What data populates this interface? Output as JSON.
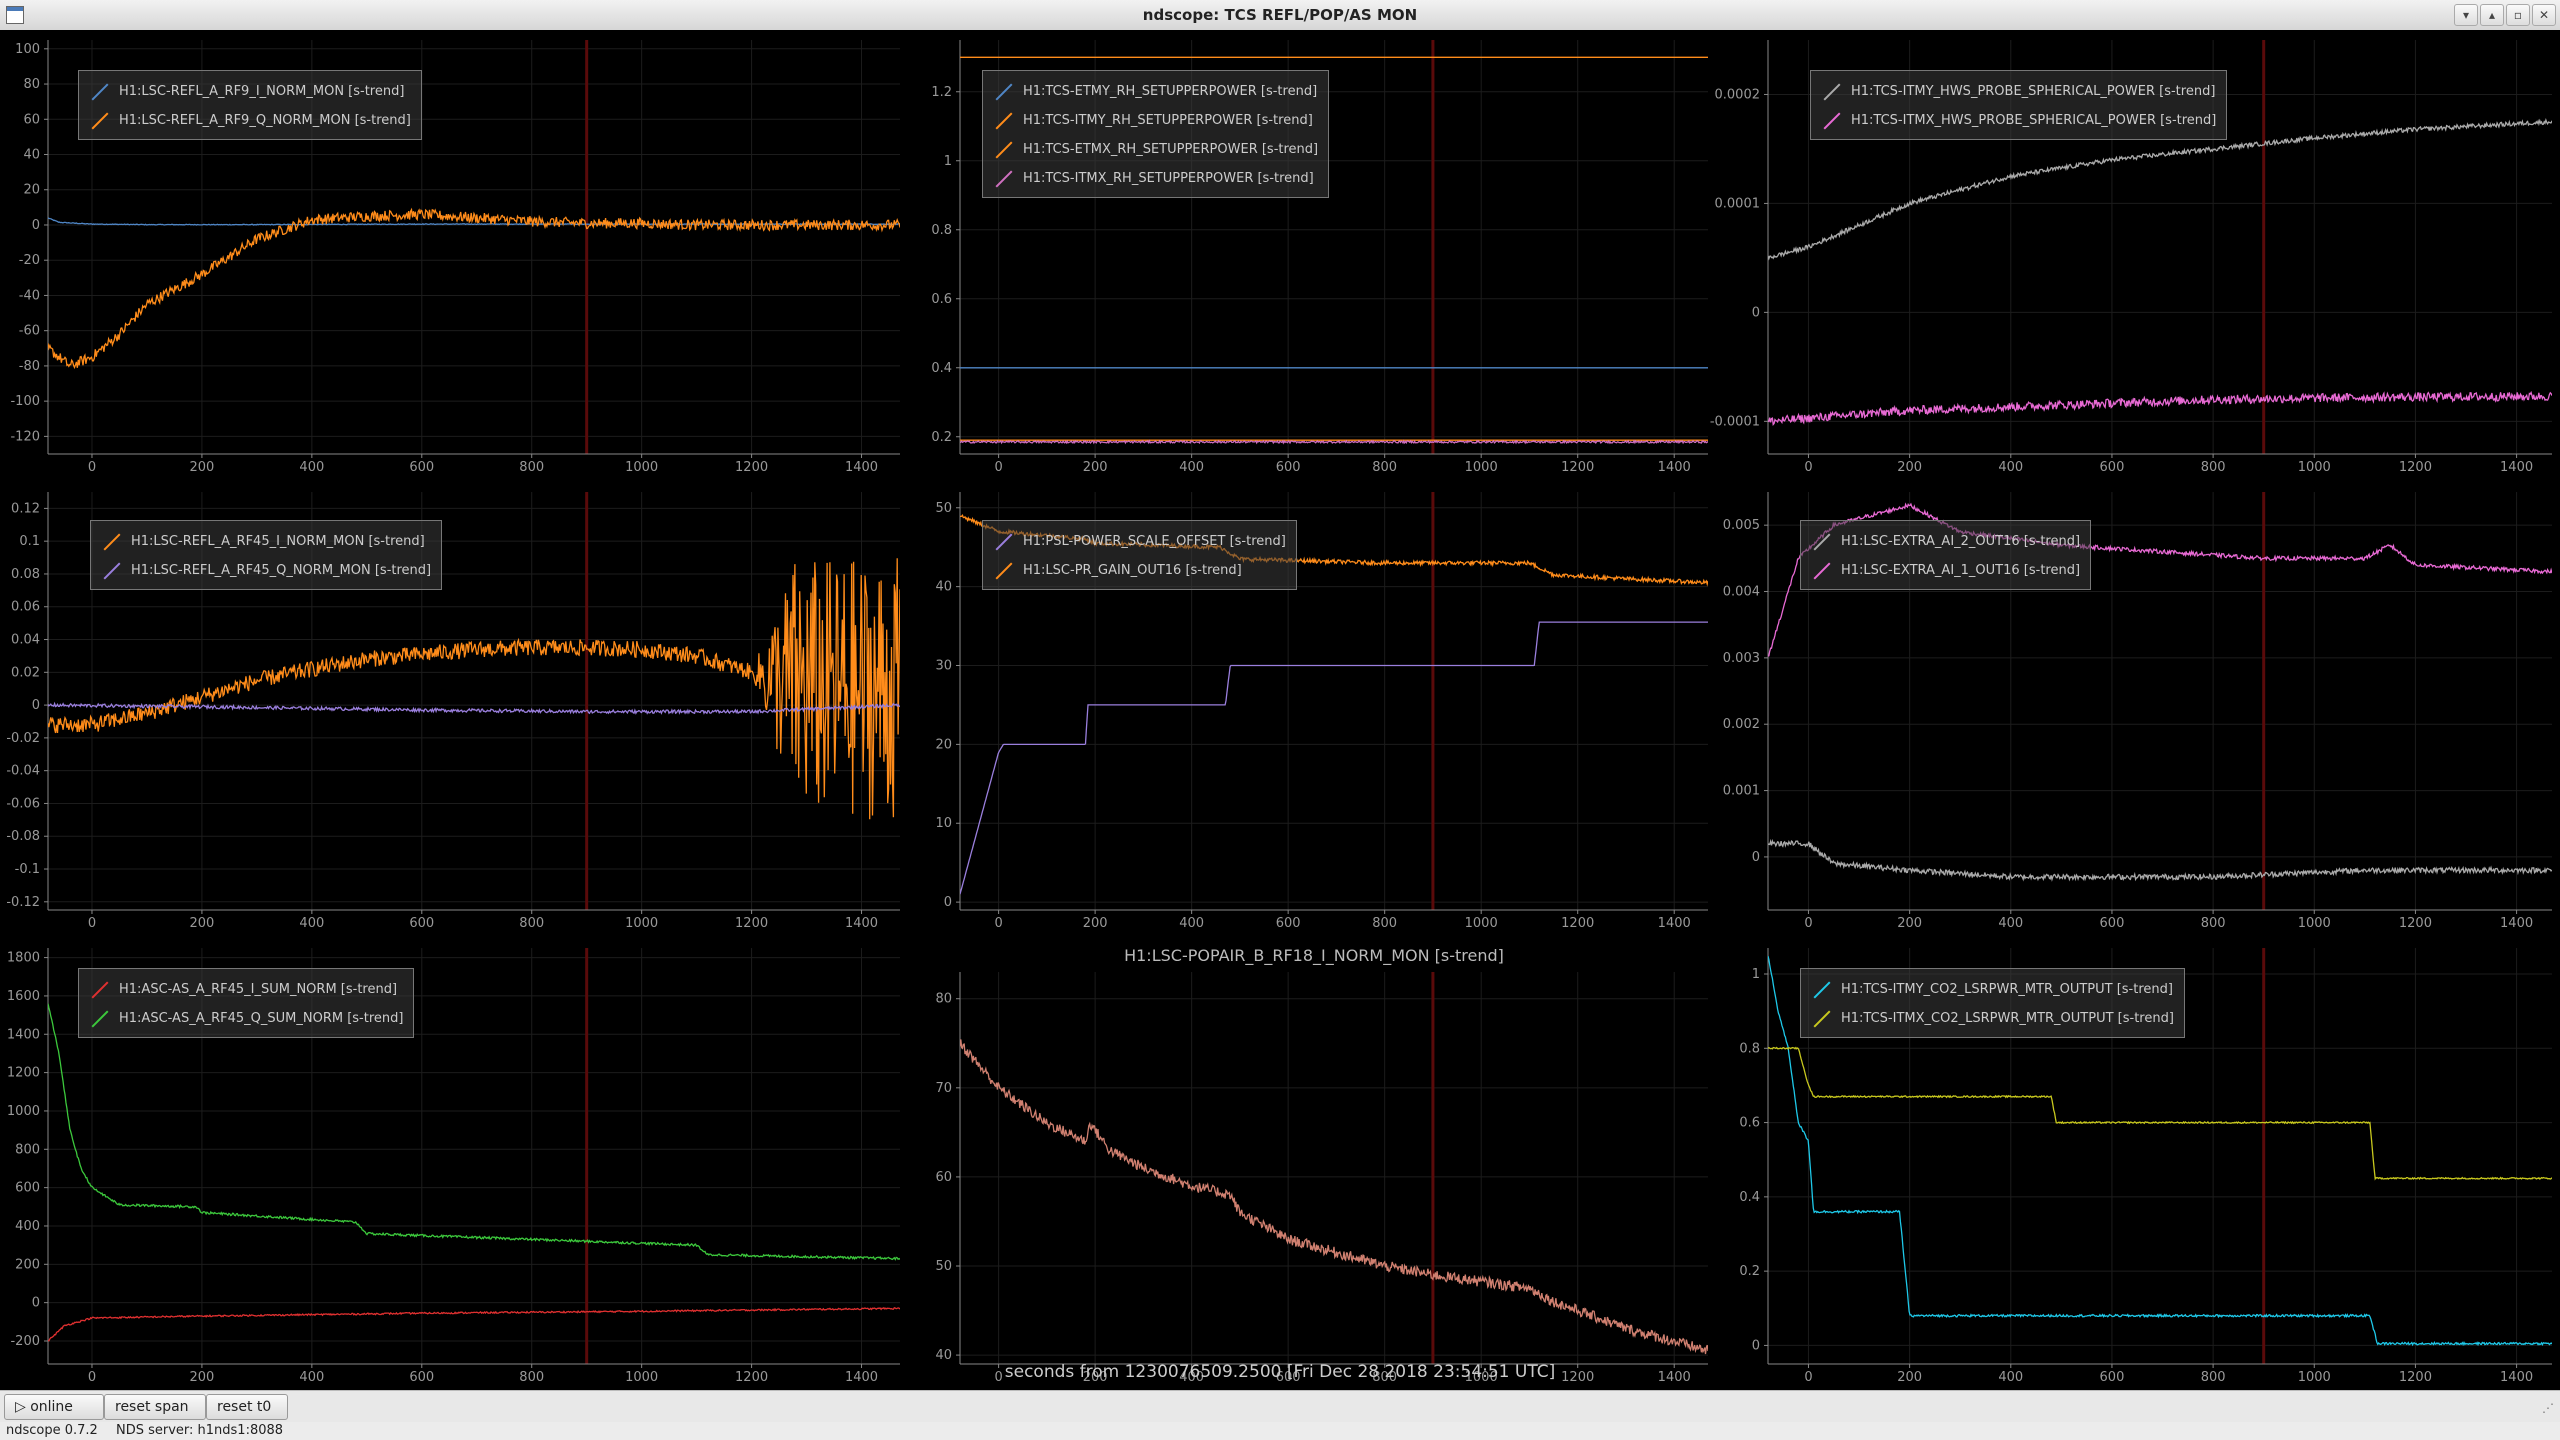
{
  "window": {
    "title": "ndscope: TCS REFL/POP/AS MON",
    "buttons": [
      "▾",
      "▴",
      "▫",
      "✕"
    ]
  },
  "x_axis_label": "seconds from 1230076509.2500 [Fri Dec 28 2018 23:54:51 UTC]",
  "toolbar": {
    "online_label": "▷ online",
    "reset_span_label": "reset span",
    "reset_t0_label": "reset t0"
  },
  "status": {
    "version": "ndscope 0.7.2",
    "server": "NDS server: h1nds1:8088"
  },
  "plots": [
    {
      "id": "refl-rf9",
      "title": "",
      "xlim": [
        -80,
        1470
      ],
      "ylim": [
        -130,
        105
      ],
      "xticks": [
        0,
        200,
        400,
        600,
        800,
        1000,
        1200,
        1400
      ],
      "yticks": [
        100,
        80,
        60,
        40,
        20,
        0,
        -20,
        -40,
        -60,
        -80,
        -100,
        -120
      ],
      "cursor_x": 900,
      "series": [
        {
          "name": "H1:LSC-REFL_A_RF9_I_NORM_MON [s-trend]",
          "color": "#4f86c6",
          "noise": 0.2,
          "points": [
            [
              -80,
              4
            ],
            [
              -60,
              1.5
            ],
            [
              0,
              0.5
            ],
            [
              100,
              0.2
            ],
            [
              300,
              0.2
            ],
            [
              600,
              0.5
            ],
            [
              900,
              0.5
            ],
            [
              1200,
              0.5
            ],
            [
              1470,
              0.5
            ]
          ]
        },
        {
          "name": "H1:LSC-REFL_A_RF9_Q_NORM_MON [s-trend]",
          "color": "#ff8c1a",
          "noise": 3,
          "points": [
            [
              -80,
              -70
            ],
            [
              -40,
              -80
            ],
            [
              0,
              -75
            ],
            [
              50,
              -62
            ],
            [
              100,
              -45
            ],
            [
              200,
              -28
            ],
            [
              300,
              -8
            ],
            [
              400,
              3
            ],
            [
              500,
              5
            ],
            [
              600,
              6
            ],
            [
              700,
              4
            ],
            [
              800,
              2
            ],
            [
              900,
              1
            ],
            [
              1000,
              1
            ],
            [
              1100,
              0
            ],
            [
              1200,
              0
            ],
            [
              1300,
              0
            ],
            [
              1470,
              0
            ]
          ]
        }
      ]
    },
    {
      "id": "tcs-setupper",
      "title": "",
      "xlim": [
        -80,
        1470
      ],
      "ylim": [
        0.15,
        1.35
      ],
      "xticks": [
        0,
        200,
        400,
        600,
        800,
        1000,
        1200,
        1400
      ],
      "yticks": [
        1.2,
        1,
        0.8,
        0.6,
        0.4,
        0.2
      ],
      "cursor_x": 900,
      "series": [
        {
          "name": "H1:TCS-ETMY_RH_SETUPPERPOWER [s-trend]",
          "color": "#4f86c6",
          "noise": 0,
          "points": [
            [
              -80,
              0.4
            ],
            [
              1470,
              0.4
            ]
          ]
        },
        {
          "name": "H1:TCS-ITMY_RH_SETUPPERPOWER [s-trend]",
          "color": "#ff8c1a",
          "noise": 0,
          "points": [
            [
              -80,
              1.3
            ],
            [
              1470,
              1.3
            ]
          ]
        },
        {
          "name": "H1:TCS-ETMX_RH_SETUPPERPOWER [s-trend]",
          "color": "#ff8c1a",
          "noise": 0,
          "points": [
            [
              -80,
              0.19
            ],
            [
              1470,
              0.19
            ]
          ]
        },
        {
          "name": "H1:TCS-ITMX_RH_SETUPPERPOWER [s-trend]",
          "color": "#d070c0",
          "noise": 0.003,
          "points": [
            [
              -80,
              0.185
            ],
            [
              1470,
              0.185
            ]
          ]
        }
      ]
    },
    {
      "id": "hws-spherical",
      "title": "",
      "xlim": [
        -80,
        1470
      ],
      "ylim": [
        -0.00013,
        0.00025
      ],
      "xticks": [
        0,
        200,
        400,
        600,
        800,
        1000,
        1200,
        1400
      ],
      "yticks": [
        0.0002,
        0.0001,
        0,
        -0.0001
      ],
      "cursor_x": 900,
      "series": [
        {
          "name": "H1:TCS-ITMY_HWS_PROBE_SPHERICAL_POWER [s-trend]",
          "color": "#aaaaaa",
          "noise": 2e-06,
          "points": [
            [
              -80,
              5e-05
            ],
            [
              0,
              6e-05
            ],
            [
              100,
              8e-05
            ],
            [
              200,
              0.0001
            ],
            [
              400,
              0.000125
            ],
            [
              600,
              0.00014
            ],
            [
              800,
              0.00015
            ],
            [
              1000,
              0.00016
            ],
            [
              1200,
              0.000168
            ],
            [
              1470,
              0.000175
            ]
          ]
        },
        {
          "name": "H1:TCS-ITMX_HWS_PROBE_SPHERICAL_POWER [s-trend]",
          "color": "#e86ad4",
          "noise": 4e-06,
          "points": [
            [
              -80,
              -0.0001
            ],
            [
              200,
              -9e-05
            ],
            [
              500,
              -8.5e-05
            ],
            [
              800,
              -8e-05
            ],
            [
              1100,
              -7.8e-05
            ],
            [
              1470,
              -7.7e-05
            ]
          ]
        }
      ]
    },
    {
      "id": "refl-rf45",
      "title": "",
      "xlim": [
        -80,
        1470
      ],
      "ylim": [
        -0.125,
        0.13
      ],
      "xticks": [
        0,
        200,
        400,
        600,
        800,
        1000,
        1200,
        1400
      ],
      "yticks": [
        0.12,
        0.1,
        0.08,
        0.06,
        0.04,
        0.02,
        0,
        -0.02,
        -0.04,
        -0.06,
        -0.08,
        -0.1,
        -0.12
      ],
      "cursor_x": 900,
      "series": [
        {
          "name": "H1:LSC-REFL_A_RF45_I_NORM_MON [s-trend]",
          "color": "#ff8c1a",
          "noise": 0.005,
          "burst": [
            1200,
            0.08
          ],
          "points": [
            [
              -80,
              -0.012
            ],
            [
              0,
              -0.012
            ],
            [
              100,
              -0.005
            ],
            [
              200,
              0.005
            ],
            [
              300,
              0.015
            ],
            [
              400,
              0.022
            ],
            [
              500,
              0.028
            ],
            [
              600,
              0.031
            ],
            [
              700,
              0.034
            ],
            [
              800,
              0.035
            ],
            [
              900,
              0.035
            ],
            [
              1000,
              0.034
            ],
            [
              1100,
              0.03
            ],
            [
              1200,
              0.02
            ],
            [
              1300,
              0.01
            ],
            [
              1470,
              0.01
            ]
          ]
        },
        {
          "name": "H1:LSC-REFL_A_RF45_Q_NORM_MON [s-trend]",
          "color": "#9a7fdd",
          "noise": 0.001,
          "points": [
            [
              -80,
              0
            ],
            [
              200,
              -0.001
            ],
            [
              600,
              -0.003
            ],
            [
              900,
              -0.004
            ],
            [
              1200,
              -0.004
            ],
            [
              1470,
              0
            ]
          ]
        }
      ]
    },
    {
      "id": "psl-power",
      "title": "",
      "xlim": [
        -80,
        1470
      ],
      "ylim": [
        -1,
        52
      ],
      "xticks": [
        0,
        200,
        400,
        600,
        800,
        1000,
        1200,
        1400
      ],
      "yticks": [
        50,
        40,
        30,
        20,
        10,
        0
      ],
      "cursor_x": 900,
      "series": [
        {
          "name": "H1:PSL-POWER_SCALE_OFFSET [s-trend]",
          "color": "#9a7fdd",
          "noise": 0,
          "points": [
            [
              -80,
              1
            ],
            [
              -40,
              10
            ],
            [
              0,
              19
            ],
            [
              10,
              20
            ],
            [
              180,
              20
            ],
            [
              185,
              25
            ],
            [
              470,
              25
            ],
            [
              480,
              30
            ],
            [
              1110,
              30
            ],
            [
              1120,
              35.5
            ],
            [
              1470,
              35.5
            ]
          ]
        },
        {
          "name": "H1:LSC-PR_GAIN_OUT16 [s-trend]",
          "color": "#ff8c1a",
          "noise": 0.25,
          "points": [
            [
              -80,
              49
            ],
            [
              0,
              47
            ],
            [
              100,
              46.5
            ],
            [
              180,
              46
            ],
            [
              200,
              45.5
            ],
            [
              460,
              45
            ],
            [
              500,
              43.5
            ],
            [
              800,
              43
            ],
            [
              1100,
              43
            ],
            [
              1150,
              41.5
            ],
            [
              1300,
              41
            ],
            [
              1470,
              40.5
            ]
          ]
        }
      ]
    },
    {
      "id": "extra-ai",
      "title": "",
      "xlim": [
        -80,
        1470
      ],
      "ylim": [
        -0.0008,
        0.0055
      ],
      "xticks": [
        0,
        200,
        400,
        600,
        800,
        1000,
        1200,
        1400
      ],
      "yticks": [
        0.005,
        0.004,
        0.003,
        0.002,
        0.001,
        0
      ],
      "cursor_x": 900,
      "series": [
        {
          "name": "H1:LSC-EXTRA_AI_2_OUT16 [s-trend]",
          "color": "#aaaaaa",
          "noise": 4e-05,
          "points": [
            [
              -80,
              0.0002
            ],
            [
              0,
              0.0002
            ],
            [
              50,
              -0.0001
            ],
            [
              200,
              -0.0002
            ],
            [
              400,
              -0.0003
            ],
            [
              800,
              -0.0003
            ],
            [
              1100,
              -0.0002
            ],
            [
              1470,
              -0.0002
            ]
          ]
        },
        {
          "name": "H1:LSC-EXTRA_AI_1_OUT16 [s-trend]",
          "color": "#e86ad4",
          "noise": 3e-05,
          "points": [
            [
              -80,
              0.003
            ],
            [
              -20,
              0.0045
            ],
            [
              50,
              0.005
            ],
            [
              200,
              0.0053
            ],
            [
              300,
              0.0049
            ],
            [
              500,
              0.0047
            ],
            [
              700,
              0.0046
            ],
            [
              900,
              0.0045
            ],
            [
              1100,
              0.0045
            ],
            [
              1150,
              0.0047
            ],
            [
              1200,
              0.0044
            ],
            [
              1470,
              0.0043
            ]
          ]
        }
      ]
    },
    {
      "id": "as-rf45",
      "title": "",
      "xlim": [
        -80,
        1470
      ],
      "ylim": [
        -320,
        1850
      ],
      "xticks": [
        0,
        200,
        400,
        600,
        800,
        1000,
        1200,
        1400
      ],
      "yticks": [
        1800,
        1600,
        1400,
        1200,
        1000,
        800,
        600,
        400,
        200,
        0,
        -200
      ],
      "cursor_x": 900,
      "series": [
        {
          "name": "H1:ASC-AS_A_RF45_I_SUM_NORM [s-trend]",
          "color": "#e03030",
          "noise": 4,
          "points": [
            [
              -80,
              -200
            ],
            [
              -50,
              -120
            ],
            [
              0,
              -80
            ],
            [
              200,
              -70
            ],
            [
              600,
              -55
            ],
            [
              1000,
              -45
            ],
            [
              1470,
              -30
            ]
          ]
        },
        {
          "name": "H1:ASC-AS_A_RF45_Q_SUM_NORM [s-trend]",
          "color": "#3cc83c",
          "noise": 6,
          "points": [
            [
              -80,
              1560
            ],
            [
              -60,
              1300
            ],
            [
              -40,
              900
            ],
            [
              -20,
              700
            ],
            [
              0,
              600
            ],
            [
              50,
              510
            ],
            [
              190,
              500
            ],
            [
              200,
              470
            ],
            [
              480,
              420
            ],
            [
              500,
              360
            ],
            [
              1100,
              300
            ],
            [
              1120,
              250
            ],
            [
              1470,
              230
            ]
          ]
        }
      ]
    },
    {
      "id": "popair-rf18",
      "title": "H1:LSC-POPAIR_B_RF18_I_NORM_MON [s-trend]",
      "xlim": [
        -80,
        1470
      ],
      "ylim": [
        39,
        83
      ],
      "xticks": [
        0,
        200,
        400,
        600,
        800,
        1000,
        1200,
        1400
      ],
      "yticks": [
        80,
        70,
        60,
        50,
        40
      ],
      "cursor_x": 900,
      "series": [
        {
          "name": "H1:LSC-POPAIR_B_RF18_I_NORM_MON [s-trend]",
          "color": "#d08070",
          "noise": 0.6,
          "points": [
            [
              -80,
              75
            ],
            [
              0,
              70
            ],
            [
              100,
              66
            ],
            [
              180,
              64
            ],
            [
              190,
              66
            ],
            [
              230,
              63
            ],
            [
              300,
              61
            ],
            [
              400,
              59
            ],
            [
              480,
              58
            ],
            [
              500,
              56
            ],
            [
              600,
              53
            ],
            [
              800,
              50
            ],
            [
              900,
              49
            ],
            [
              1100,
              47.5
            ],
            [
              1150,
              46
            ],
            [
              1300,
              43
            ],
            [
              1470,
              40.5
            ]
          ]
        }
      ]
    },
    {
      "id": "co2-lsrpwr",
      "title": "",
      "xlim": [
        -80,
        1470
      ],
      "ylim": [
        -0.05,
        1.07
      ],
      "xticks": [
        0,
        200,
        400,
        600,
        800,
        1000,
        1200,
        1400
      ],
      "yticks": [
        1,
        0.8,
        0.6,
        0.4,
        0.2,
        0
      ],
      "cursor_x": 900,
      "series": [
        {
          "name": "H1:TCS-ITMY_CO2_LSRPWR_MTR_OUTPUT [s-trend]",
          "color": "#1ec8e8",
          "noise": 0.003,
          "points": [
            [
              -80,
              1.05
            ],
            [
              -60,
              0.9
            ],
            [
              -40,
              0.8
            ],
            [
              -20,
              0.6
            ],
            [
              0,
              0.55
            ],
            [
              10,
              0.36
            ],
            [
              180,
              0.36
            ],
            [
              200,
              0.08
            ],
            [
              1110,
              0.08
            ],
            [
              1125,
              0.005
            ],
            [
              1470,
              0.005
            ]
          ]
        },
        {
          "name": "H1:TCS-ITMX_CO2_LSRPWR_MTR_OUTPUT [s-trend]",
          "color": "#c8c81e",
          "noise": 0.002,
          "points": [
            [
              -80,
              0.8
            ],
            [
              -20,
              0.8
            ],
            [
              0,
              0.7
            ],
            [
              10,
              0.67
            ],
            [
              480,
              0.67
            ],
            [
              490,
              0.6
            ],
            [
              1110,
              0.6
            ],
            [
              1120,
              0.45
            ],
            [
              1470,
              0.45
            ]
          ]
        }
      ]
    }
  ]
}
